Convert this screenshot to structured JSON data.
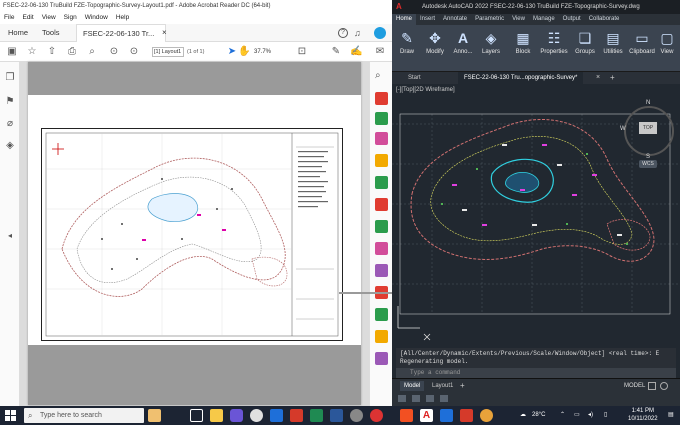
{
  "acrobat": {
    "title": "FSEC-22-06-130 TruBuild FZE-Topographic-Survey-Layout1.pdf - Adobe Acrobat Reader DC (64-bit)",
    "menu": [
      "File",
      "Edit",
      "View",
      "Sign",
      "Window",
      "Help"
    ],
    "tabs": {
      "home": "Home",
      "tools": "Tools",
      "doc": "FSEC-22-06-130 Tr..."
    },
    "page_label": "[1] Layout1",
    "page_of": "(1 of 1)",
    "zoom": "37.7%"
  },
  "autocad": {
    "title": "Autodesk AutoCAD 2022   FSEC-22-06-130 TruBuild FZE-Topographic-Survey.dwg",
    "ribbon_tabs": [
      "Home",
      "Insert",
      "Annotate",
      "Parametric",
      "View",
      "Manage",
      "Output",
      "Collaborate"
    ],
    "ribbon_buttons": [
      "Draw",
      "Modify",
      "Anno...",
      "Layers",
      "Block",
      "Properties",
      "Groups",
      "Utilities",
      "Clipboard",
      "View"
    ],
    "file_tabs": {
      "start": "Start",
      "doc": "FSEC-22-06-130 Tru...opographic-Survey*"
    },
    "viewport_label": "[-][Top][2D Wireframe]",
    "viewcube": {
      "n": "N",
      "s": "S",
      "w": "W",
      "top": "TOP",
      "wcs": "WCS"
    },
    "command_history": "[All/Center/Dynamic/Extents/Previous/Scale/Window/Object] <real time>: E",
    "command_history2": "Regenerating model.",
    "command_placeholder": "Type a command",
    "layout_tabs": [
      "Model",
      "Layout1"
    ],
    "status_model": "MODEL"
  },
  "taskbar": {
    "search_placeholder": "Type here to search",
    "weather": "28°C",
    "time": "1:41 PM",
    "date": "10/11/2022"
  }
}
